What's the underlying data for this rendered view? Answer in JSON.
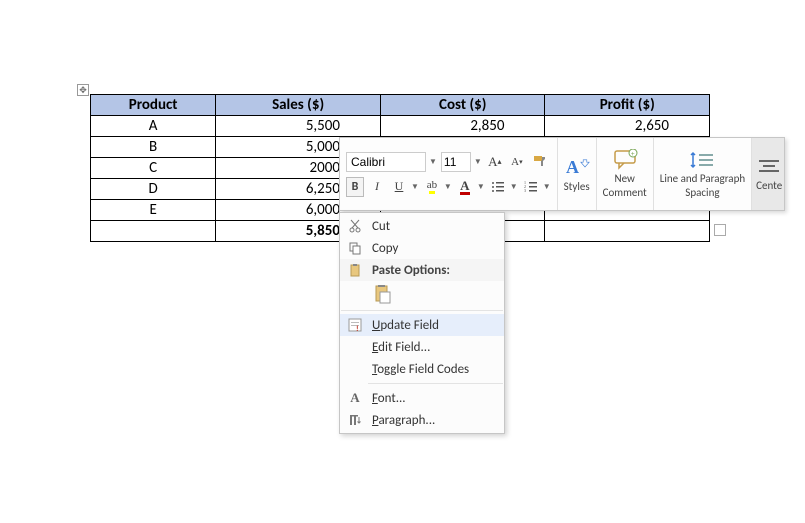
{
  "table": {
    "headers": [
      "Product",
      "Sales ($)",
      "Cost ($)",
      "Profit ($)"
    ],
    "rows": [
      {
        "product": "A",
        "sales": "5,500",
        "cost": "2,850",
        "profit": "2,650"
      },
      {
        "product": "B",
        "sales": "5,000",
        "cost": "",
        "profit": ""
      },
      {
        "product": "C",
        "sales": "2000",
        "cost": "",
        "profit": ""
      },
      {
        "product": "D",
        "sales": "6,250",
        "cost": "",
        "profit": ""
      },
      {
        "product": "E",
        "sales": "6,000",
        "cost": "",
        "profit": ""
      }
    ],
    "footer": {
      "product": "",
      "sales": "5,850",
      "cost": "",
      "profit": ""
    }
  },
  "mini_toolbar": {
    "font_name": "Calibri",
    "font_size": "11",
    "styles_label": "Styles",
    "new_comment_label1": "New",
    "new_comment_label2": "Comment",
    "lp_label1": "Line and Paragraph",
    "lp_label2": "Spacing",
    "center_label": "Cente"
  },
  "ctx": {
    "cut": "Cut",
    "copy": "Copy",
    "paste_options": "Paste Options:",
    "update_field": "Update Field",
    "edit_field": "Edit Field...",
    "toggle_field_codes": "Toggle Field Codes",
    "font": "Font...",
    "paragraph": "Paragraph..."
  }
}
